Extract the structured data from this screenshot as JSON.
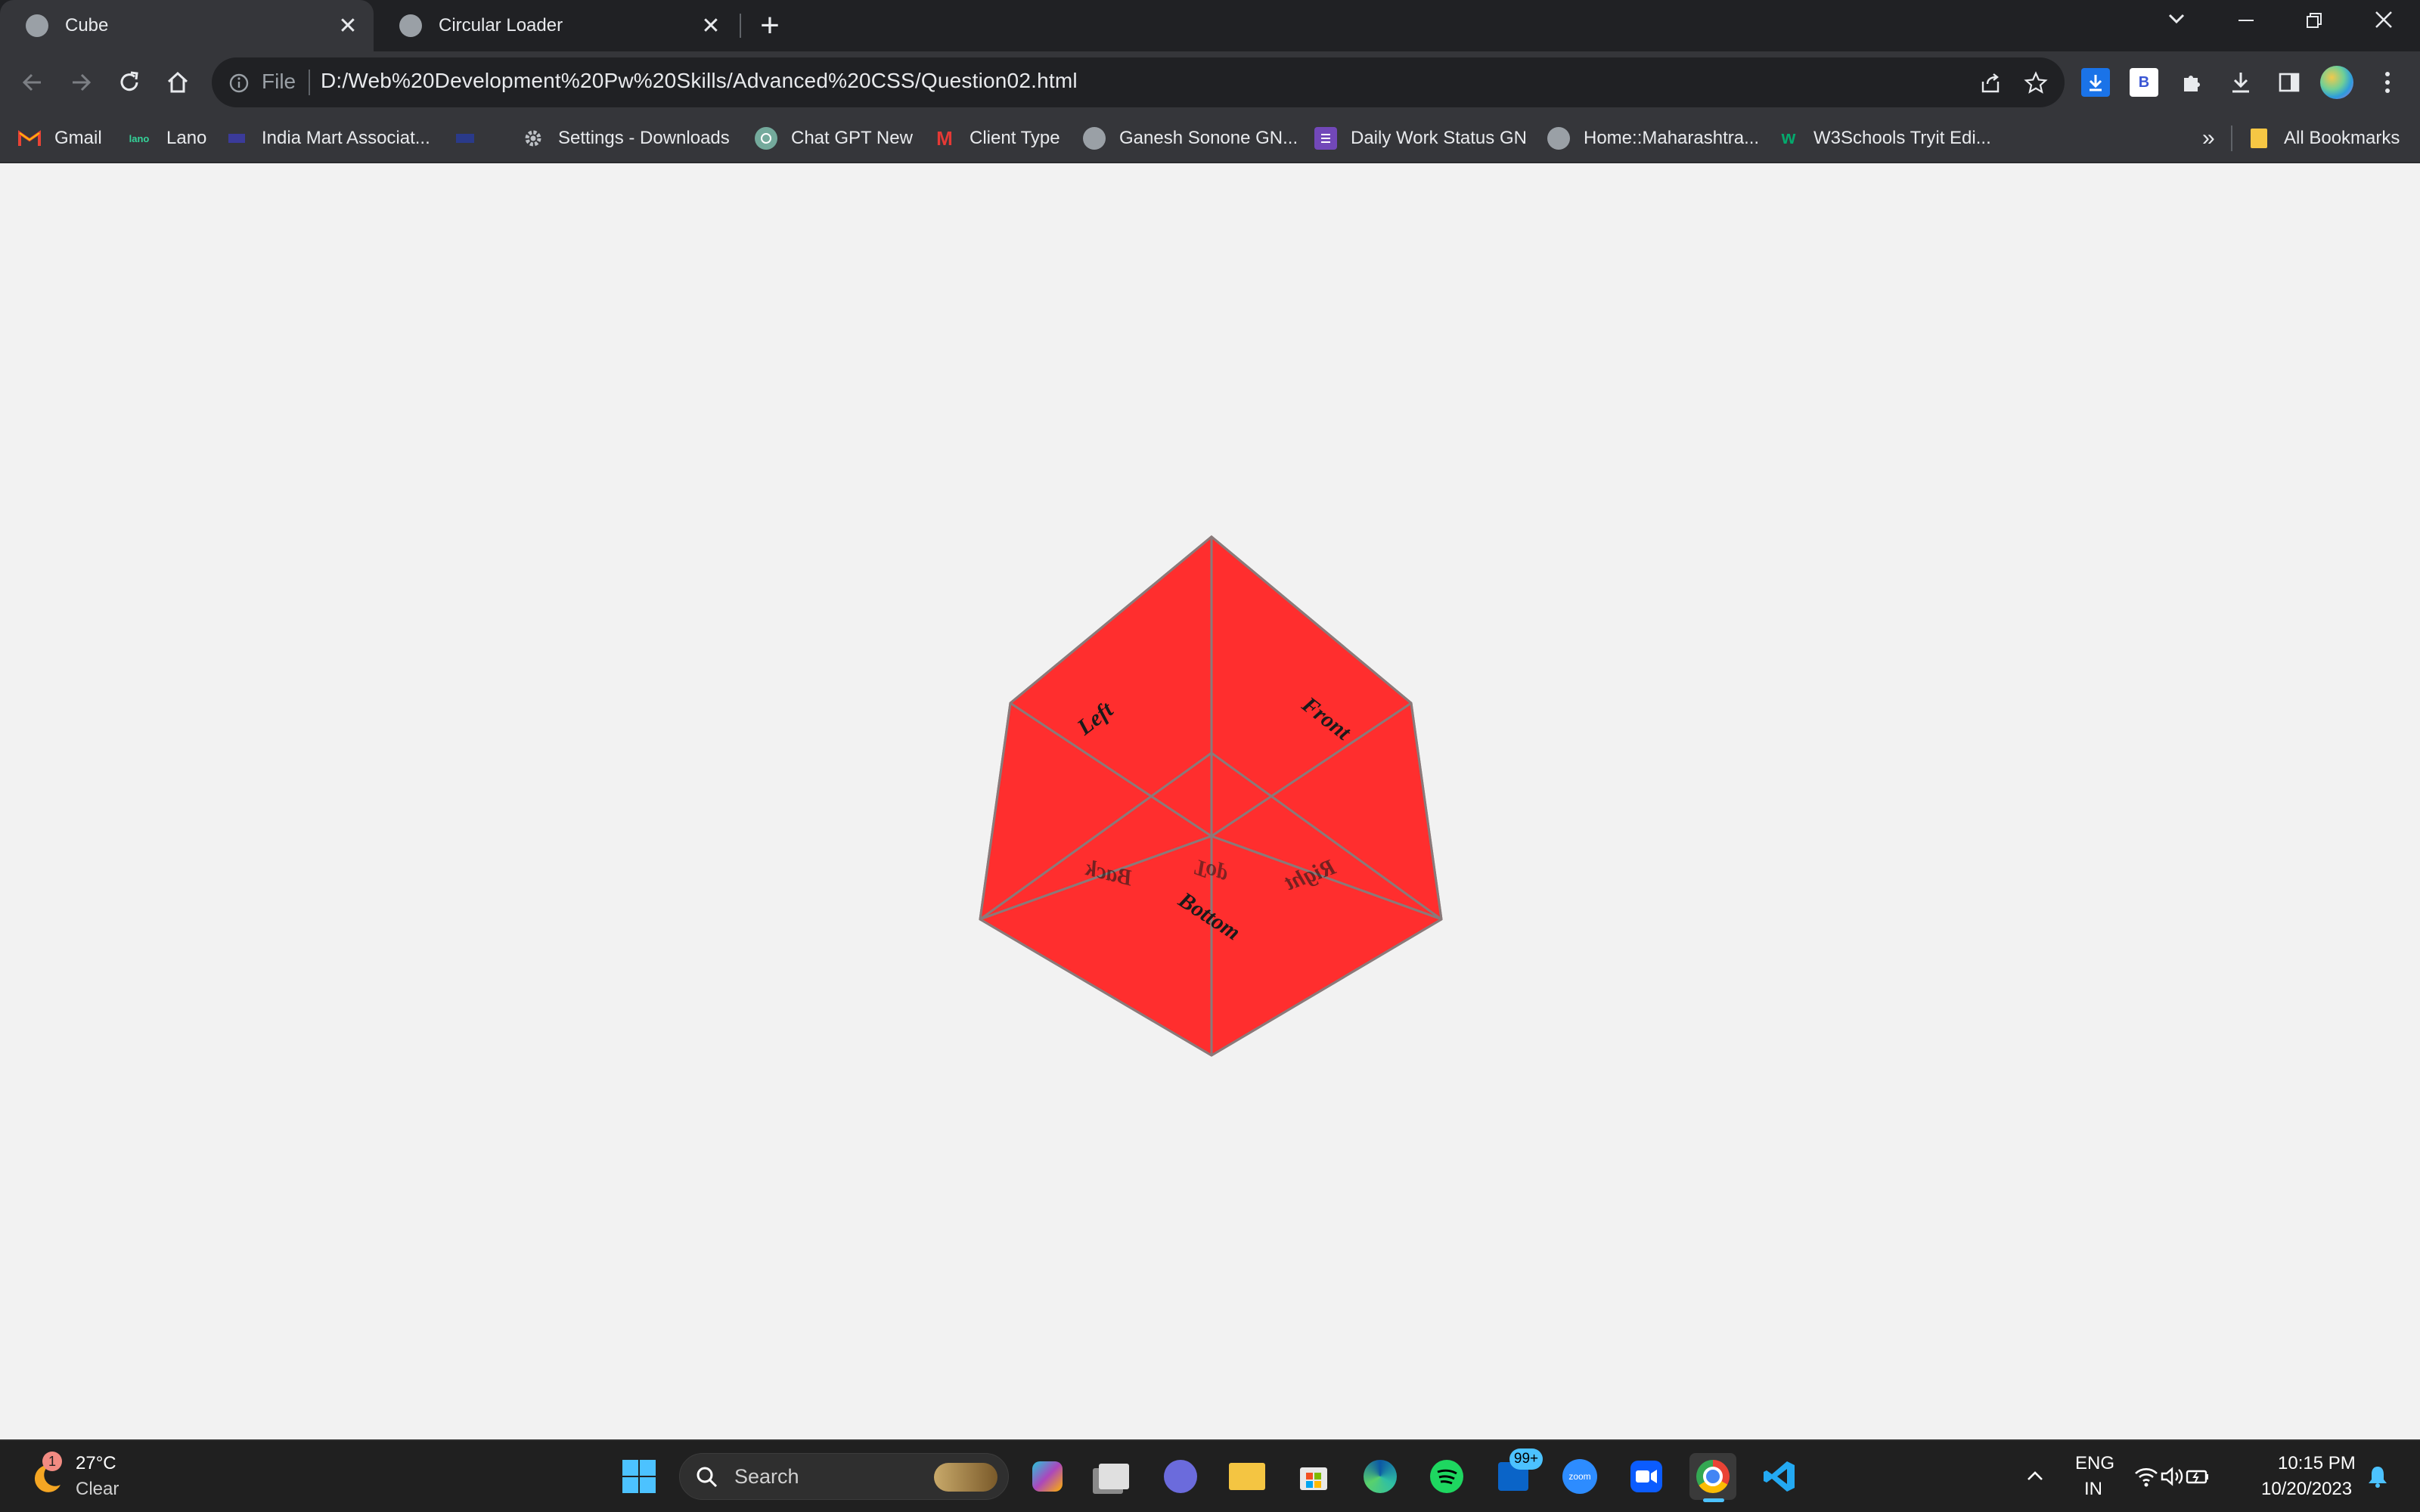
{
  "browser": {
    "tabs": [
      {
        "title": "Cube",
        "active": true
      },
      {
        "title": "Circular Loader",
        "active": false
      }
    ],
    "new_tab_glyph": "+",
    "address": {
      "scheme_label": "File",
      "url": "D:/Web%20Development%20Pw%20Skills/Advanced%20CSS/Question02.html"
    },
    "bookmarks": [
      {
        "label": "Gmail",
        "icon": "gmail-icon"
      },
      {
        "label": "Lano",
        "icon": "lano-icon"
      },
      {
        "label": "India Mart Associat...",
        "icon": "indiamart-icon"
      },
      {
        "label": "",
        "icon": "bookmark-flag-icon"
      },
      {
        "label": "Settings - Downloads",
        "icon": "gear-icon"
      },
      {
        "label": "Chat GPT New",
        "icon": "chatgpt-icon"
      },
      {
        "label": "Client Type",
        "icon": "m-logo-icon"
      },
      {
        "label": "Ganesh Sonone GN...",
        "icon": "globe-icon"
      },
      {
        "label": "Daily Work Status GN",
        "icon": "forms-icon"
      },
      {
        "label": "Home::Maharashtra...",
        "icon": "globe-icon"
      },
      {
        "label": "W3Schools Tryit Edi...",
        "icon": "w3schools-icon"
      }
    ],
    "overflow_label": "»",
    "all_bookmarks_label": "All Bookmarks"
  },
  "page": {
    "cube_faces": {
      "top": "Top",
      "left": "Left",
      "front": "Front",
      "back": "Back",
      "right": "Right",
      "bottom": "Bottom"
    },
    "colors": {
      "background": "#f2f2f2",
      "cube_face": "#ff2e2e",
      "cube_edge": "#8a7a7a"
    }
  },
  "taskbar": {
    "weather": {
      "temperature": "27°C",
      "condition": "Clear",
      "badge": "1"
    },
    "search_placeholder": "Search",
    "mail_badge": "99+",
    "zoom_label": "zoom",
    "language": {
      "line1": "ENG",
      "line2": "IN"
    },
    "clock": {
      "time": "10:15 PM",
      "date": "10/20/2023"
    }
  }
}
